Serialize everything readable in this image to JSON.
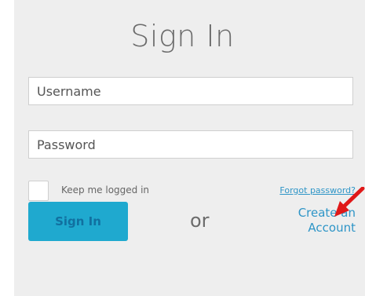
{
  "header": {
    "title": "Sign In"
  },
  "form": {
    "username_placeholder": "Username",
    "password_placeholder": "Password",
    "keep_logged_in_label": "Keep me logged in",
    "forgot_password_label": "Forgot password?",
    "sign_in_label": "Sign In",
    "or_label": "or",
    "create_account_line1": "Create an",
    "create_account_line2": "Account"
  },
  "colors": {
    "panel_background": "#eeeeee",
    "accent_button": "#1fa9cf",
    "link": "#2e95c7",
    "annotation_arrow": "#e01818"
  },
  "icons": {
    "annotation": "red-arrow-icon"
  }
}
